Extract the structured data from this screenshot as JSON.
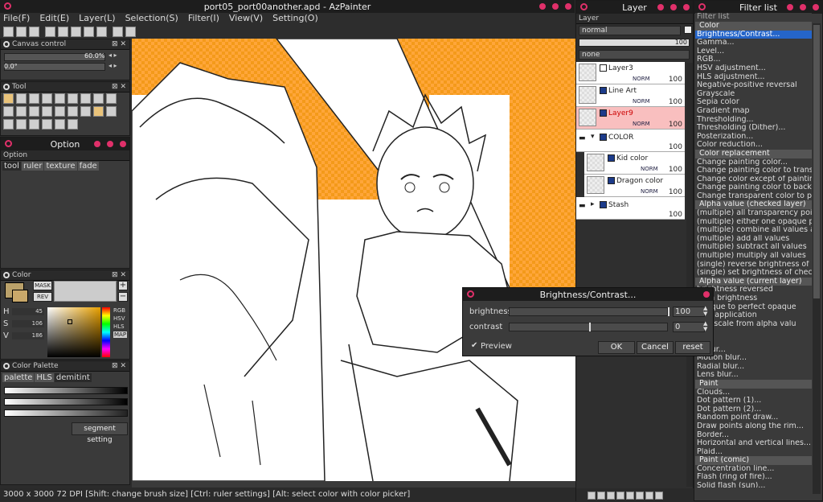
{
  "main": {
    "title": "port05_port00another.apd - AzPainter",
    "menu": [
      "File(F)",
      "Edit(E)",
      "Layer(L)",
      "Selection(S)",
      "Filter(I)",
      "View(V)",
      "Setting(O)"
    ]
  },
  "canvas_control": {
    "title": "Canvas control",
    "zoom": "60.0%",
    "angle": "0.0°"
  },
  "tool_panel": {
    "title": "Tool"
  },
  "option_panel": {
    "title": "Option",
    "sub": "Option",
    "tabs": [
      "tool",
      "ruler",
      "texture",
      "fade"
    ]
  },
  "color_panel": {
    "title": "Color",
    "mask": "MASK",
    "rev": "REV",
    "h_label": "H",
    "h": "45",
    "s_label": "S",
    "s": "106",
    "v_label": "V",
    "v": "186",
    "modes": [
      "RGB",
      "HSV",
      "HLS",
      "MAP"
    ],
    "swatch_color": "#baa16a"
  },
  "palette_panel": {
    "title": "Color Palette",
    "tabs": [
      "palette",
      "HLS",
      "demitint"
    ],
    "segment_button": "segment setting"
  },
  "layer_panel": {
    "title": "Layer",
    "blend_mode": "normal",
    "opacity": "100",
    "texture": "none",
    "layers": [
      {
        "name": "Layer3",
        "mode": "NORM",
        "opacity": "100",
        "selected": false
      },
      {
        "name": "Line Art",
        "mode": "NORM",
        "opacity": "100",
        "selected": false
      },
      {
        "name": "Layer9",
        "mode": "NORM",
        "opacity": "100",
        "selected": true
      },
      {
        "name": "COLOR",
        "mode": "",
        "opacity": "100",
        "selected": false
      },
      {
        "name": "Kid color",
        "mode": "NORM",
        "opacity": "100",
        "selected": false
      },
      {
        "name": "Dragon color",
        "mode": "NORM",
        "opacity": "100",
        "selected": false
      },
      {
        "name": "Stash",
        "mode": "",
        "opacity": "100",
        "selected": false
      }
    ]
  },
  "filter_panel": {
    "title": "Filter list",
    "header": "Filter list",
    "items": [
      {
        "t": "Color",
        "cat": true
      },
      {
        "t": "Brightness/Contrast...",
        "sel": true
      },
      {
        "t": "Gamma..."
      },
      {
        "t": "Level..."
      },
      {
        "t": "RGB..."
      },
      {
        "t": "HSV adjustment..."
      },
      {
        "t": "HLS adjustment..."
      },
      {
        "t": "Negative-positive reversal"
      },
      {
        "t": "Grayscale"
      },
      {
        "t": "Sepia color"
      },
      {
        "t": "Gradient map"
      },
      {
        "t": "Thresholding..."
      },
      {
        "t": "Thresholding (Dither)..."
      },
      {
        "t": "Posterization..."
      },
      {
        "t": "Color reduction..."
      },
      {
        "t": "Color replacement",
        "cat": true
      },
      {
        "t": "Change painting color..."
      },
      {
        "t": "Change painting color to transp"
      },
      {
        "t": "Change color except of painting"
      },
      {
        "t": "Change painting color to backgr"
      },
      {
        "t": "Change transparent color to pai"
      },
      {
        "t": "Alpha value (checked layer)",
        "cat": true
      },
      {
        "t": "(multiple) all transparency point"
      },
      {
        "t": "(multiple) either one opaque po"
      },
      {
        "t": "(multiple) combine all values an"
      },
      {
        "t": "(multiple) add all values"
      },
      {
        "t": "(multiple) subtract all values"
      },
      {
        "t": "(multiple) multiply all values"
      },
      {
        "t": "(single) reverse brightness of che"
      },
      {
        "t": "(single) set brightness of checke"
      },
      {
        "t": "Alpha value (current layer)",
        "cat": true
      },
      {
        "t": "brightness reversed"
      },
      {
        "t": "from brightness"
      },
      {
        "t": "opaque to perfect opaque"
      },
      {
        "t": "ture application"
      },
      {
        "t": "grayscale from alpha valu"
      },
      {
        "t": ""
      },
      {
        "t": ""
      },
      {
        "t": "...blur..."
      },
      {
        "t": "Motion blur..."
      },
      {
        "t": "Radial blur..."
      },
      {
        "t": "Lens blur..."
      },
      {
        "t": "Paint",
        "cat": true
      },
      {
        "t": "Clouds..."
      },
      {
        "t": "Dot pattern (1)..."
      },
      {
        "t": "Dot pattern (2)..."
      },
      {
        "t": "Random point draw..."
      },
      {
        "t": "Draw points along the rim..."
      },
      {
        "t": "Border..."
      },
      {
        "t": "Horizontal and vertical lines..."
      },
      {
        "t": "Plaid..."
      },
      {
        "t": "Paint (comic)",
        "cat": true
      },
      {
        "t": "Concentration line..."
      },
      {
        "t": "Flash (ring of fire)..."
      },
      {
        "t": "Solid flash (sun)..."
      }
    ]
  },
  "dialog": {
    "title": "Brightness/Contrast...",
    "brightness_label": "brightness",
    "brightness_value": "100",
    "contrast_label": "contrast",
    "contrast_value": "0",
    "preview_label": "Preview",
    "ok": "OK",
    "cancel": "Cancel",
    "reset": "reset"
  },
  "status": "3000 x 3000 72 DPI  [Shift: change brush size] [Ctrl: ruler settings] [Alt: select color with color picker]"
}
